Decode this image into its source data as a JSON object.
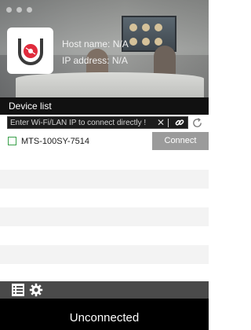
{
  "header": {
    "host_label": "Host name: N/A",
    "ip_label": "IP address: N/A"
  },
  "device_list": {
    "title": "Device list",
    "search_placeholder": "Enter Wi-Fi/LAN IP to connect directly !",
    "devices": [
      {
        "name": "MTS-100SY-7514",
        "action": "Connect"
      }
    ]
  },
  "status": {
    "text": "Unconnected"
  },
  "icons": {
    "logo": "app-logo-icon",
    "clear": "close-icon",
    "link": "link-icon",
    "refresh": "refresh-icon",
    "list": "list-icon",
    "settings": "gear-icon"
  },
  "colors": {
    "accent_green": "#3aa04a",
    "logo_red": "#e02b3c",
    "connect_bg": "#9b9b9b"
  }
}
